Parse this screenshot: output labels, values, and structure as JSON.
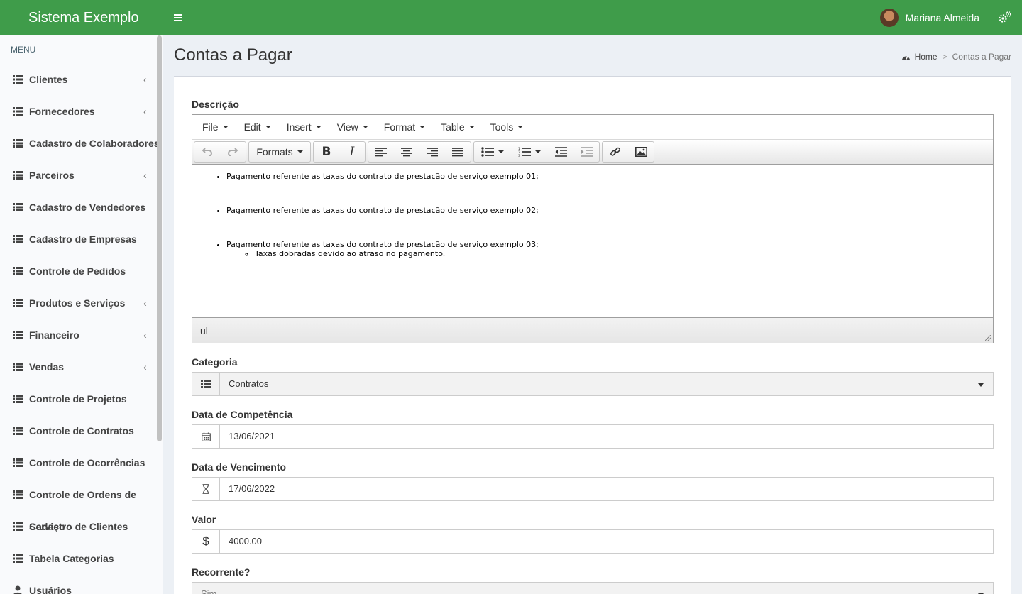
{
  "header": {
    "brand": "Sistema Exemplo",
    "user_name": "Mariana Almeida",
    "accent_color": "#3f9c4a"
  },
  "sidebar": {
    "menu_label": "MENU",
    "items": [
      {
        "label": "Clientes",
        "icon": "list-icon",
        "submenu": true
      },
      {
        "label": "Fornecedores",
        "icon": "list-icon",
        "submenu": true
      },
      {
        "label": "Cadastro de Colaboradores",
        "icon": "list-icon",
        "submenu": false
      },
      {
        "label": "Parceiros",
        "icon": "list-icon",
        "submenu": true
      },
      {
        "label": "Cadastro de Vendedores",
        "icon": "list-icon",
        "submenu": false
      },
      {
        "label": "Cadastro de Empresas",
        "icon": "list-icon",
        "submenu": false
      },
      {
        "label": "Controle de Pedidos",
        "icon": "list-icon",
        "submenu": false
      },
      {
        "label": "Produtos e Serviços",
        "icon": "list-icon",
        "submenu": true
      },
      {
        "label": "Financeiro",
        "icon": "list-icon",
        "submenu": true
      },
      {
        "label": "Vendas",
        "icon": "list-icon",
        "submenu": true
      },
      {
        "label": "Controle de Projetos",
        "icon": "list-icon",
        "submenu": false
      },
      {
        "label": "Controle de Contratos",
        "icon": "list-icon",
        "submenu": false
      },
      {
        "label": "Controle de Ocorrências",
        "icon": "list-icon",
        "submenu": false
      },
      {
        "label": "Controle de Ordens de Serviço",
        "icon": "list-icon",
        "submenu": false
      },
      {
        "label": "Cadastro de Clientes",
        "icon": "list-icon",
        "submenu": false
      },
      {
        "label": "Tabela Categorias",
        "icon": "list-icon",
        "submenu": false
      },
      {
        "label": "Usuários",
        "icon": "user-icon",
        "submenu": false
      }
    ]
  },
  "page": {
    "title": "Contas a Pagar",
    "breadcrumb": {
      "home": "Home",
      "separator": ">",
      "current": "Contas a Pagar"
    }
  },
  "form": {
    "descricao_label": "Descrição",
    "editor": {
      "menus": [
        "File",
        "Edit",
        "Insert",
        "View",
        "Format",
        "Table",
        "Tools"
      ],
      "formats_label": "Formats",
      "content": {
        "items": [
          "Pagamento referente as taxas do contrato de prestação de serviço exemplo 01;",
          "Pagamento referente as taxas do contrato de prestação de serviço exemplo 02;",
          "Pagamento referente as taxas do contrato de prestação de serviço exemplo 03;"
        ],
        "sub_item": "Taxas dobradas devido ao atraso no pagamento."
      },
      "status_path": "ul"
    },
    "categoria": {
      "label": "Categoria",
      "value": "Contratos"
    },
    "data_competencia": {
      "label": "Data de Competência",
      "value": "13/06/2021"
    },
    "data_vencimento": {
      "label": "Data de Vencimento",
      "value": "17/06/2022"
    },
    "valor": {
      "label": "Valor",
      "value": "4000.00",
      "addon": "$"
    },
    "recorrente": {
      "label": "Recorrente?",
      "value": "Sim"
    }
  }
}
